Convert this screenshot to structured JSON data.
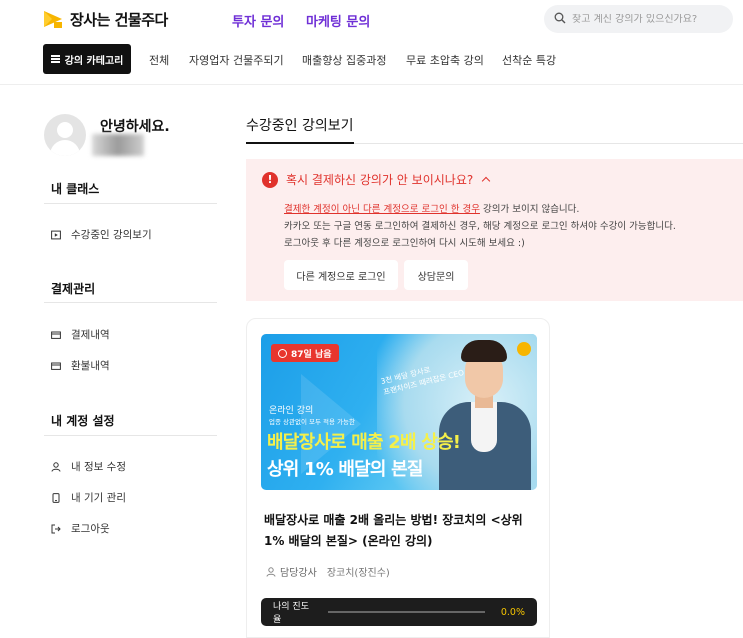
{
  "header": {
    "brand": "장사는 건물주다",
    "links": [
      "투자 문의",
      "마케팅 문의"
    ],
    "search_placeholder": "찾고 계신 강의가 있으신가요?"
  },
  "nav": {
    "category_button": "강의 카테고리",
    "items": [
      "전체",
      "자영업자 건물주되기",
      "매출향상 집중과정",
      "무료 초압축 강의",
      "선착순 특강"
    ]
  },
  "sidebar": {
    "greeting": "안녕하세요.",
    "sections": [
      {
        "title": "내 클래스",
        "items": [
          {
            "label": "수강중인 강의보기",
            "icon": "play-icon"
          }
        ]
      },
      {
        "title": "결제관리",
        "items": [
          {
            "label": "결제내역",
            "icon": "card-icon"
          },
          {
            "label": "환불내역",
            "icon": "card-icon"
          }
        ]
      },
      {
        "title": "내 계정 설정",
        "items": [
          {
            "label": "내 정보 수정",
            "icon": "user-icon"
          },
          {
            "label": "내 기기 관리",
            "icon": "device-icon"
          },
          {
            "label": "로그아웃",
            "icon": "logout-icon"
          }
        ]
      }
    ]
  },
  "main": {
    "title": "수강중인 강의보기",
    "notice": {
      "heading": "혹시 결제하신 강의가 안 보이시나요?",
      "line1_link": "결제한 계정이 아닌 다른 계정으로 로그인 한 경우",
      "line1_rest": " 강의가 보이지 않습니다.",
      "line2": "카카오 또는 구글 연동 로그인하여 결제하신 경우, 해당 계정으로 로그인 하셔야 수강이 가능합니다.",
      "line3": "로그아웃 후 다른 계정으로 로그인하여 다시 시도해 보세요 :)",
      "buttons": [
        "다른 계정으로 로그인",
        "상담문의"
      ]
    },
    "course": {
      "badge": "87일 남음",
      "thumb_handwriting_1": "3천 배달 장사로",
      "thumb_handwriting_2": "프랜차이즈 때려잡은 CEO",
      "thumb_sub": "온라인 강의",
      "thumb_sub2": "업종 상관없이 모두 적용 가능한",
      "thumb_main": "배달장사로 매출 2배 상승!",
      "thumb_main2": "상위 1% 배달의 본질",
      "title": "배달장사로 매출 2배 올리는 방법! 장코치의 <상위 1% 배달의 본질> (온라인 강의)",
      "teacher_label": "담당강사",
      "teacher_name": "장코치(장진수)",
      "progress_label": "나의 진도율",
      "progress_value": "0.0%",
      "progress_fraction": 0
    }
  },
  "colors": {
    "accent_purple": "#6f2fd6",
    "alert_red": "#e0322c",
    "brand_yellow": "#f7b500",
    "progress_yellow": "#f5c400"
  }
}
